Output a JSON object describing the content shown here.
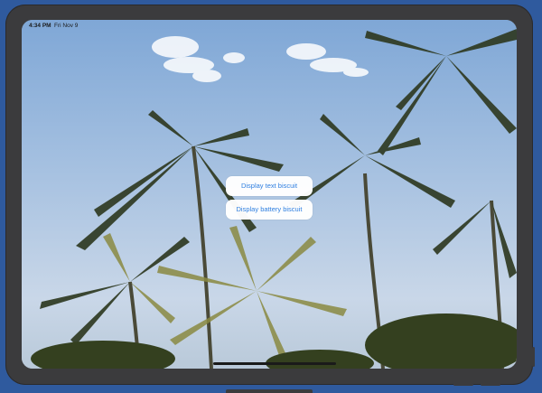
{
  "status_bar": {
    "time": "4:34 PM",
    "date": "Fri Nov 9"
  },
  "buttons": {
    "text_biscuit": "Display text biscuit",
    "battery_biscuit": "Display battery biscuit"
  },
  "colors": {
    "background": "#2f5a9e",
    "device_frame": "#3b3b3d",
    "button_text": "#2f7fe0",
    "button_bg": "#ffffff"
  },
  "icons": [
    "home-indicator"
  ]
}
